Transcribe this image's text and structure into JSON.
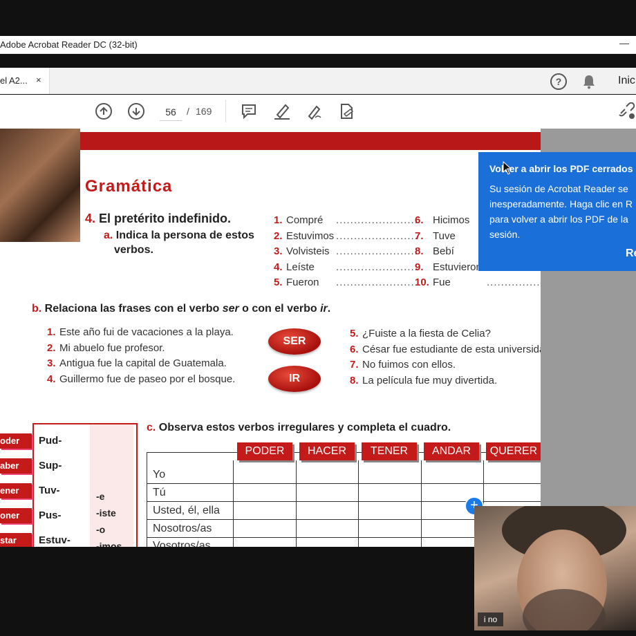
{
  "app": {
    "title": "Adobe Acrobat Reader DC (32-bit)",
    "minimize": "—"
  },
  "tab": {
    "label": "el A2...",
    "close": "×"
  },
  "header": {
    "help": "?",
    "account": "Inic"
  },
  "toolbar": {
    "page_current": "56",
    "separator": "/",
    "page_total": "169"
  },
  "doc": {
    "section_title": "Gramática",
    "ex4": {
      "num": "4.",
      "title": "El pretérito indefinido.",
      "a_letter": "a.",
      "a_text": "Indica la persona de estos",
      "a_text2": "verbos."
    },
    "list_a": [
      {
        "n": "1.",
        "w": "Compré",
        "d": "......................."
      },
      {
        "n": "2.",
        "w": "Estuvimos",
        "d": "......................."
      },
      {
        "n": "3.",
        "w": "Volvisteis",
        "d": "......................."
      },
      {
        "n": "4.",
        "w": "Leíste",
        "d": "......................."
      },
      {
        "n": "5.",
        "w": "Fueron",
        "d": "......................."
      }
    ],
    "list_b": [
      {
        "n": "6.",
        "w": "Hicimos"
      },
      {
        "n": "7.",
        "w": "Tuve"
      },
      {
        "n": "8.",
        "w": "Bebí"
      },
      {
        "n": "9.",
        "w": "Estuvieron"
      },
      {
        "n": "10.",
        "w": "Fue",
        "d": "......................."
      }
    ],
    "ex_b": {
      "letter": "b.",
      "text1": "Relaciona las frases con el verbo ",
      "ser": "ser",
      "text2": " o con el verbo ",
      "ir": "ir",
      "dot": "."
    },
    "sentences_left": [
      {
        "n": "1.",
        "t": "Este año fui de vacaciones a la playa."
      },
      {
        "n": "2.",
        "t": "Mi abuelo fue profesor."
      },
      {
        "n": "3.",
        "t": "Antigua fue la capital de Guatemala."
      },
      {
        "n": "4.",
        "t": "Guillermo fue de paseo por el bosque."
      }
    ],
    "sentences_right": [
      {
        "n": "5.",
        "t": "¿Fuiste a la fiesta de Celia?"
      },
      {
        "n": "6.",
        "t": "César fue estudiante de esta universidad"
      },
      {
        "n": "7.",
        "t": "No fuimos con ellos."
      },
      {
        "n": "8.",
        "t": "La película fue muy divertida."
      }
    ],
    "pill_ser": "SER",
    "pill_ir": "IR",
    "ex_c": {
      "letter": "c.",
      "text": "Observa estos verbos irregulares y completa el cuadro."
    },
    "side_tags": [
      "oder",
      "aber",
      "ener",
      "oner",
      "star"
    ],
    "stems": [
      "Pud-",
      "Sup-",
      "Tuv-",
      "Pus-",
      "Estuv-"
    ],
    "endings": [
      "-e",
      "-iste",
      "-o",
      "-imos"
    ],
    "columns": [
      "PODER",
      "HACER",
      "TENER",
      "ANDAR",
      "QUERER"
    ],
    "rows": [
      "Yo",
      "Tú",
      "Usted, él, ella",
      "Nosotros/as",
      "Vosotros/as"
    ]
  },
  "notification": {
    "title": "Volver a abrir los PDF cerrados",
    "lines": [
      "Su sesión de Acrobat Reader se",
      "inesperadamente. Haga clic en R",
      "para volver a abrir los PDF de la",
      "sesión."
    ],
    "action": "Re"
  },
  "video": {
    "name": "i no"
  },
  "colors": {
    "accent_red": "#c41a1a",
    "notice_blue": "#1a6fd8"
  },
  "icons": [
    "prev-page-icon",
    "next-page-icon",
    "comment-icon",
    "highlight-icon",
    "sign-icon",
    "edit-pdf-icon",
    "share-link-icon",
    "help-icon",
    "bell-icon"
  ]
}
